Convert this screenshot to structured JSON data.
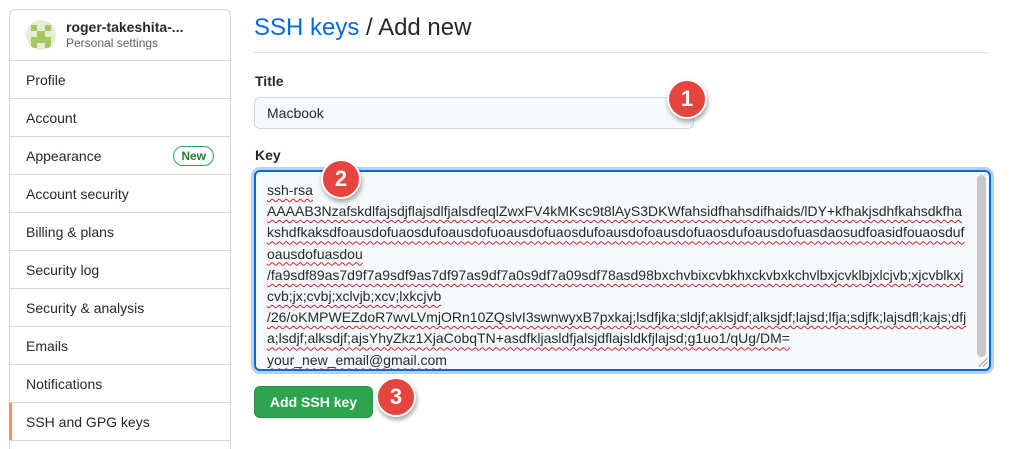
{
  "sidebar": {
    "account_name": "roger-takeshita-...",
    "account_sub": "Personal settings",
    "items": [
      {
        "label": "Profile"
      },
      {
        "label": "Account"
      },
      {
        "label": "Appearance",
        "badge": "New"
      },
      {
        "label": "Account security"
      },
      {
        "label": "Billing & plans"
      },
      {
        "label": "Security log"
      },
      {
        "label": "Security & analysis"
      },
      {
        "label": "Emails"
      },
      {
        "label": "Notifications"
      },
      {
        "label": "SSH and GPG keys"
      }
    ]
  },
  "header": {
    "crumb_link": "SSH keys",
    "separator": " / ",
    "current": "Add new"
  },
  "form": {
    "title_label": "Title",
    "title_value": "Macbook",
    "key_label": "Key",
    "key_lines": [
      "ssh-rsa",
      "AAAAB3NzafskdlfajsdjflajsdlfjalsdfeqlZwxFV4kMKsc9t8lAyS3DKWfahsidfhahsdifhaids/lDY+kfhakjsdhfkahsdkfhakshdfkaksdfoausdofuaosdufoausdofuoausdofuaosdufoausdofoausdofuaosdufoausdofuasdaosudfoasidfouaosdufoausdofuasdou",
      "/fa9sdf89as7d9f7a9sdf9as7df97as9df7a0s9df7a09sdf78asd98bxchvbixcvbkhxckvbxkchvlbxjcvklbjxlcjvb;xjcvblkxjcvb;jx;cvbj;xclvjb;xcv;lxkcjvb",
      "/26/oKMPWEZdoR7wvLVmjORn10ZQslvI3swnwyxB7pxkaj;lsdfjka;sldjf;aklsjdf;alksjdf;lajsd;lfja;sdjfk;lajsdfl;kajs;dfja;lsdjf;alksdjf;ajsYhyZkz1XjaCobqTN+asdfkljasldfjalsjdflajsldkfjlajsd;g1uo1/qUg/DM=",
      "your_new_email@gmail.com"
    ],
    "submit_label": "Add SSH key"
  },
  "steps": [
    "1",
    "2",
    "3"
  ],
  "colors": {
    "link": "#0969da",
    "primary_button": "#2da44e",
    "step_marker": "#e5453e",
    "active_nav_accent": "#fd8c73"
  }
}
